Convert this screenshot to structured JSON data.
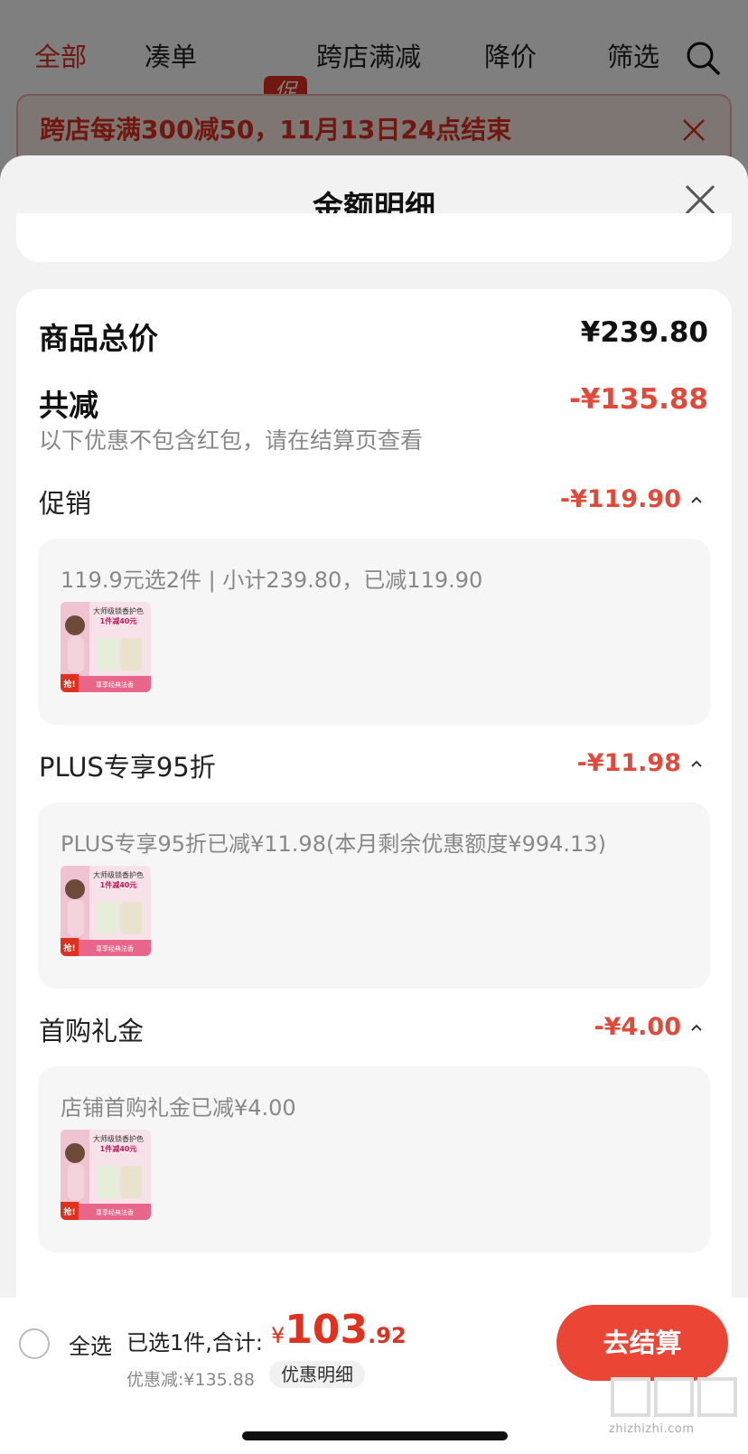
{
  "tabs": {
    "items": [
      {
        "label": "全部"
      },
      {
        "label": "凑单"
      },
      {
        "label": "跨店满减"
      },
      {
        "label": "降价"
      },
      {
        "label": "筛选"
      }
    ],
    "promo_badge": "促"
  },
  "banner": {
    "text": "跨店每满300减50，11月13日24点结束"
  },
  "sheet": {
    "title": "金额明细"
  },
  "summary": {
    "total_label": "商品总价",
    "total_value": "¥239.80",
    "reduce_label": "共减",
    "reduce_value": "-¥135.88",
    "note": "以下优惠不包含红包，请在结算页查看"
  },
  "sections": [
    {
      "label": "促销",
      "value": "-¥119.90",
      "detail": "119.9元选2件 | 小计239.80，已减119.90"
    },
    {
      "label": "PLUS专享95折",
      "value": "-¥11.98",
      "detail": "PLUS专享95折已减¥11.98(本月剩余优惠额度¥994.13)"
    },
    {
      "label": "首购礼金",
      "value": "-¥4.00",
      "detail": "店铺首购礼金已减¥4.00"
    }
  ],
  "product_thumb": {
    "line1": "大师级锁香护色",
    "line2": "1件减40元",
    "tag": "抢!",
    "footer": "尊享经典法香"
  },
  "bottom": {
    "select_all": "全选",
    "selected_info": "已选1件,合计:",
    "currency": "¥",
    "total_int": "103",
    "total_dec": ".92",
    "discount_info": "优惠减:¥135.88",
    "detail_link": "优惠明细",
    "checkout": "去结算"
  },
  "watermark": "zhizhizhi.com",
  "colors": {
    "accent": "#e0301e",
    "discount_red": "#e14a3a",
    "checkout_bg": "#ea4535"
  }
}
